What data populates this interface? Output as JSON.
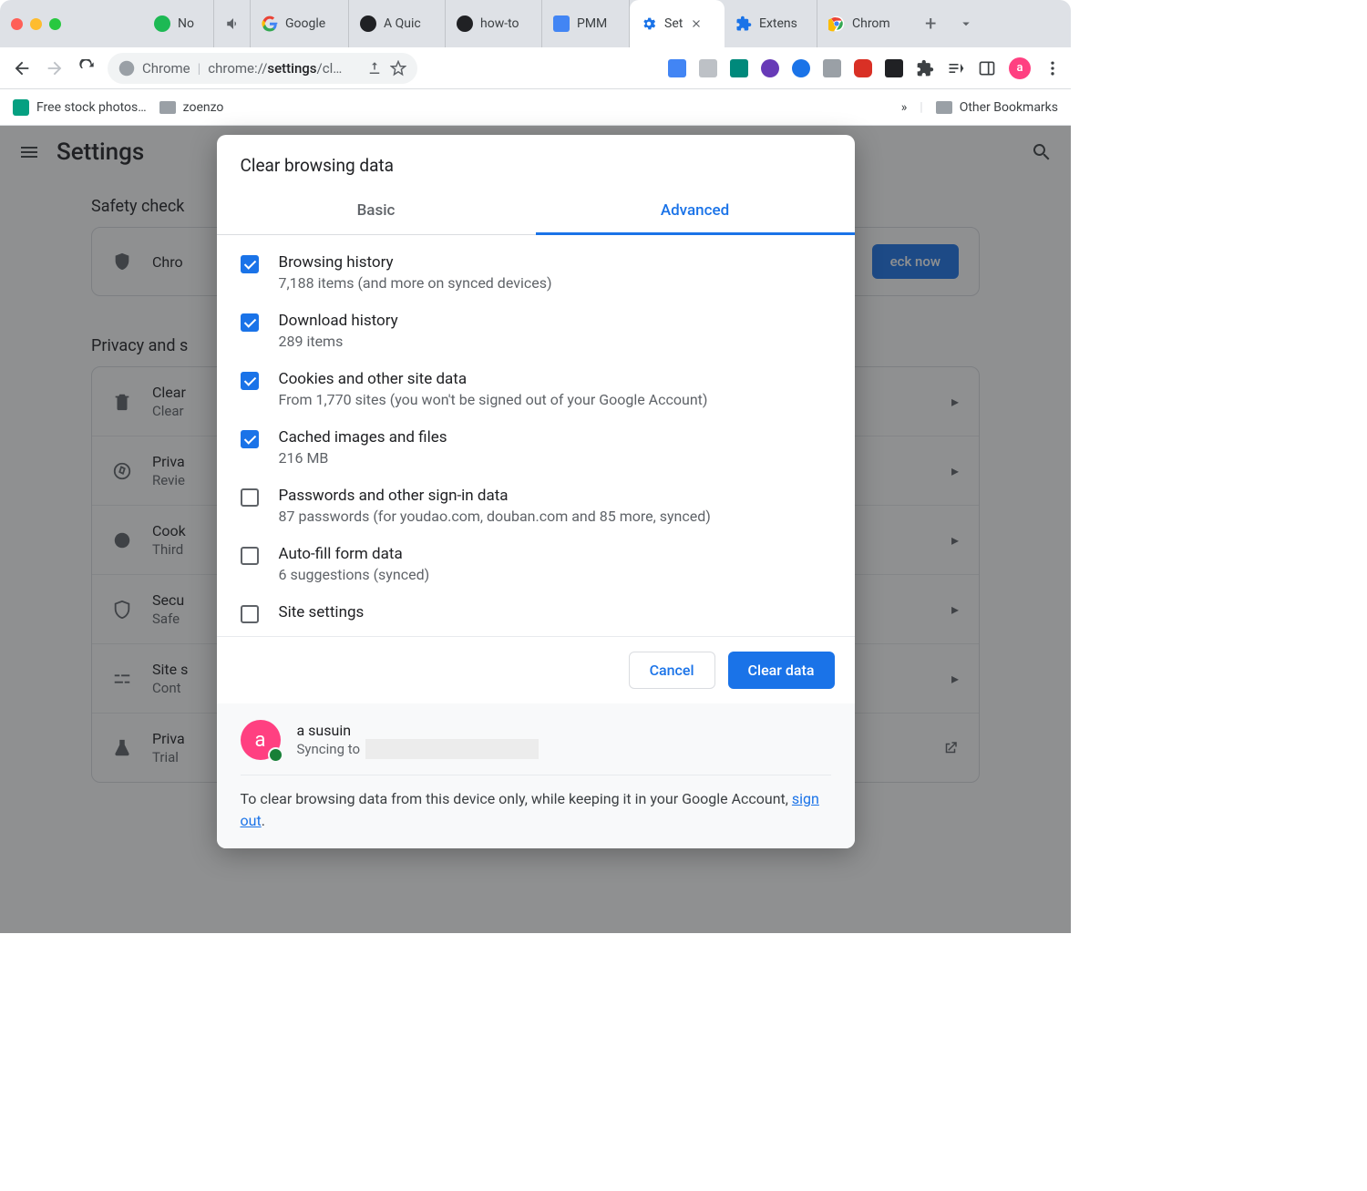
{
  "window": {
    "tabs": [
      {
        "label": "No",
        "favicon": "spotify"
      },
      {
        "label": "",
        "favicon": "sound"
      },
      {
        "label": "Google",
        "favicon": "google"
      },
      {
        "label": "A Quic",
        "favicon": "dark"
      },
      {
        "label": "how-to",
        "favicon": "dark"
      },
      {
        "label": "PMM",
        "favicon": "doc"
      },
      {
        "label": "Set",
        "favicon": "gear",
        "active": true
      },
      {
        "label": "Extens",
        "favicon": "puzzle"
      },
      {
        "label": "Chrom",
        "favicon": "chrome"
      }
    ],
    "url_prefix": "Chrome",
    "url": "chrome://settings/cl…"
  },
  "bookmarks": {
    "items": [
      "Free stock photos…",
      "zoenzo"
    ],
    "other": "Other Bookmarks"
  },
  "settings": {
    "title": "Settings",
    "safety_label": "Safety check",
    "safety_row": {
      "title": "Chro",
      "button": "eck now"
    },
    "privacy_label": "Privacy and s",
    "rows": [
      {
        "title": "Clear",
        "sub": "Clear"
      },
      {
        "title": "Priva",
        "sub": "Revie"
      },
      {
        "title": "Cook",
        "sub": "Third"
      },
      {
        "title": "Secu",
        "sub": "Safe"
      },
      {
        "title": "Site s",
        "sub": "Cont"
      },
      {
        "title": "Priva",
        "sub": "Trial"
      }
    ]
  },
  "dialog": {
    "title": "Clear browsing data",
    "tabs": {
      "basic": "Basic",
      "advanced": "Advanced"
    },
    "items": [
      {
        "checked": true,
        "title": "Browsing history",
        "sub": "7,188 items (and more on synced devices)"
      },
      {
        "checked": true,
        "title": "Download history",
        "sub": "289 items"
      },
      {
        "checked": true,
        "title": "Cookies and other site data",
        "sub": "From 1,770 sites (you won't be signed out of your Google Account)"
      },
      {
        "checked": true,
        "title": "Cached images and files",
        "sub": "216 MB"
      },
      {
        "checked": false,
        "title": "Passwords and other sign-in data",
        "sub": "87 passwords (for youdao.com, douban.com and 85 more, synced)"
      },
      {
        "checked": false,
        "title": "Auto-fill form data",
        "sub": "6 suggestions (synced)"
      },
      {
        "checked": false,
        "title": "Site settings",
        "sub": ""
      }
    ],
    "cancel": "Cancel",
    "confirm": "Clear data",
    "account": {
      "name": "a susuin",
      "status": "Syncing to",
      "avatar_letter": "a"
    },
    "footer_pre": "To clear browsing data from this device only, while keeping it in your Google Account, ",
    "footer_link": "sign out",
    "footer_post": "."
  }
}
